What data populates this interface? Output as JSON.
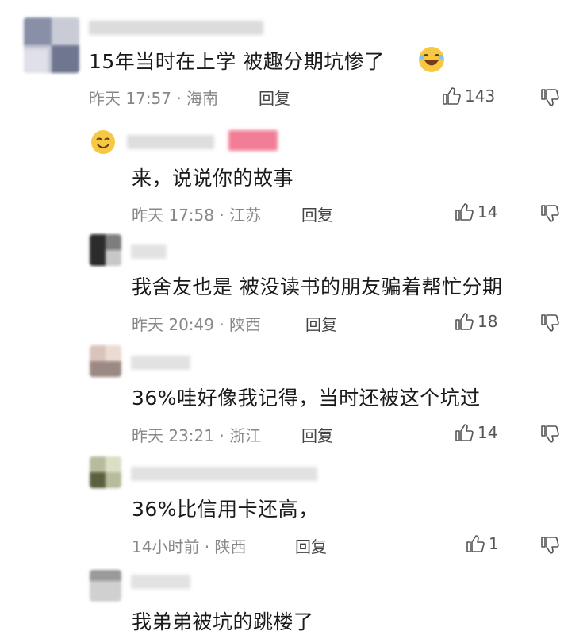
{
  "comments": [
    {
      "text": "15年当时在上学 被趣分期坑惨了",
      "time": "昨天 17:57",
      "region": "海南",
      "reply_label": "回复",
      "likes": "143"
    },
    {
      "text": "来，说说你的故事",
      "time": "昨天 17:58",
      "region": "江苏",
      "reply_label": "回复",
      "likes": "14"
    },
    {
      "text": "我舍友也是 被没读书的朋友骗着帮忙分期",
      "time": "昨天 20:49",
      "region": "陕西",
      "reply_label": "回复",
      "likes": "18"
    },
    {
      "text": "36%哇好像我记得，当时还被这个坑过",
      "time": "昨天 23:21",
      "region": "浙江",
      "reply_label": "回复",
      "likes": "14"
    },
    {
      "text": "36%比信用卡还高，",
      "time": "14小时前",
      "region": "陕西",
      "reply_label": "回复",
      "likes": "1"
    },
    {
      "text": "我弟弟被坑的跳楼了"
    }
  ],
  "icons": {
    "like": "thumbs-up-icon",
    "dislike": "thumbs-down-icon",
    "laugh": "laughing-emoji-icon",
    "smile": "smiling-emoji-icon"
  },
  "colors": {
    "text": "#1a1a1a",
    "meta": "#888888",
    "accent_pink": "#f27d96"
  }
}
